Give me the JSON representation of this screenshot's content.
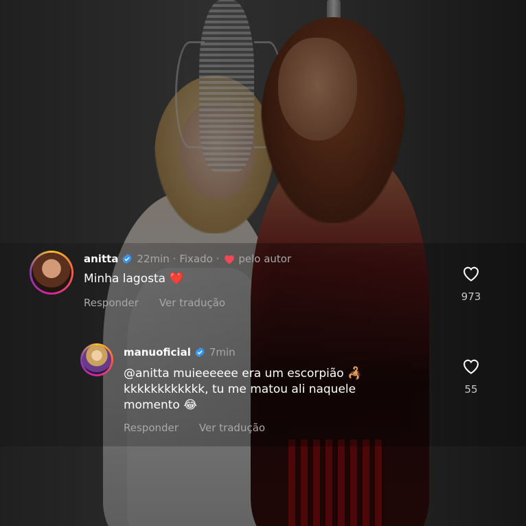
{
  "colors": {
    "verified_blue": "#3897f0",
    "heart_red": "#ed4956",
    "meta_grey": "#a8a8a8"
  },
  "comments": [
    {
      "username": "anitta",
      "verified": true,
      "time": "22min",
      "pinned_label": "· Fixado ·",
      "liked_by_author_label": "pelo autor",
      "text": "Minha lagosta",
      "text_emoji": "❤️",
      "reply_label": "Responder",
      "translate_label": "Ver tradução",
      "like_count": "973",
      "avatar_icon": "profile-avatar"
    },
    {
      "username": "manuoficial",
      "verified": true,
      "time": "7min",
      "line1": "@anitta muieeeeee era um escorpião",
      "line1_emoji": "🦂",
      "line2": "kkkkkkkkkkkk, tu me matou ali naquele",
      "line3": "momento",
      "line3_emoji": "😂",
      "reply_label": "Responder",
      "translate_label": "Ver tradução",
      "like_count": "55",
      "avatar_icon": "profile-avatar"
    }
  ]
}
